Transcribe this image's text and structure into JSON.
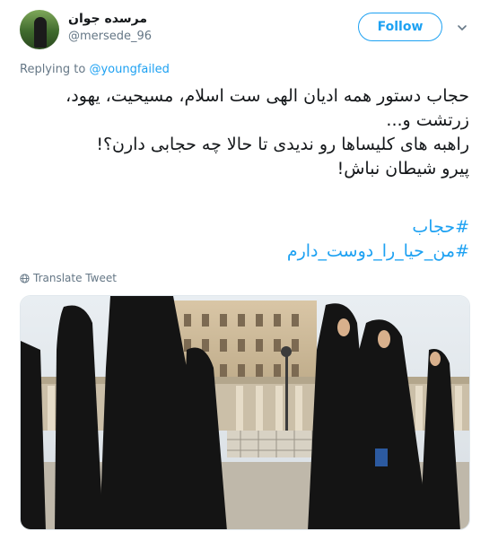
{
  "user": {
    "display_name": "مرسده جوان",
    "handle": "@mersede_96"
  },
  "follow_button": {
    "label": "Follow"
  },
  "reply": {
    "prefix": "Replying to",
    "mention": "@youngfailed"
  },
  "tweet": {
    "lines": [
      "حجاب دستور همه ادیان الهی ست اسلام، مسیحیت، یهود، زرتشت و...",
      "راهبه های کلیساها رو ندیدی تا حالا چه حجابی دارن؟!",
      "پیرو شیطان نباش!"
    ],
    "hashtags": [
      "#حجاب",
      "#من_حیا_را_دوست_دارم"
    ]
  },
  "translate": {
    "label": "Translate Tweet"
  },
  "icons": {
    "caret": "chevron-down-icon",
    "globe": "globe-icon"
  },
  "colors": {
    "accent": "#1da1f2",
    "secondary_text": "#657786",
    "primary_text": "#14171a"
  }
}
